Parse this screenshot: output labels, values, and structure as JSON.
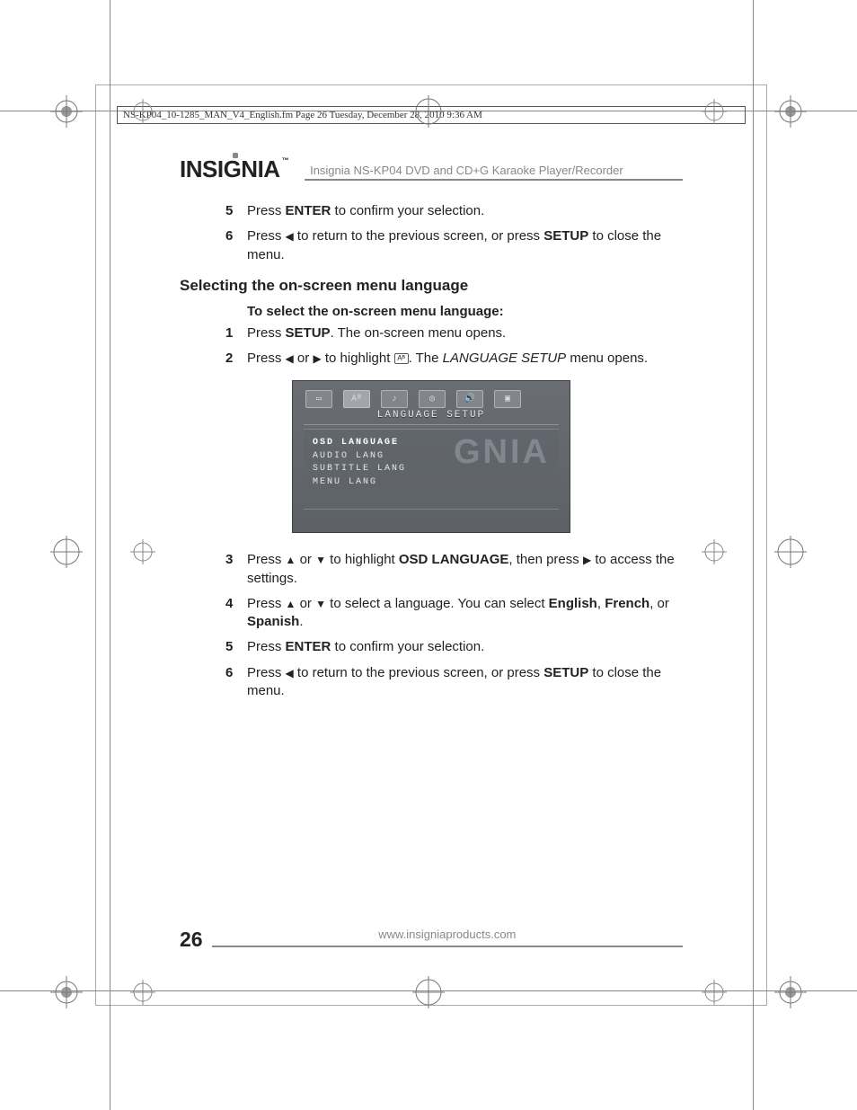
{
  "file_header": "NS-KP04_10-1285_MAN_V4_English.fm  Page 26  Tuesday, December 28, 2010  9:36 AM",
  "brand": "INSIGNIA",
  "product_line": "Insignia NS-KP04 DVD and CD+G Karaoke Player/Recorder",
  "top_steps": {
    "s5": {
      "num": "5",
      "pre": "Press ",
      "b1": "ENTER",
      "post": " to confirm your selection."
    },
    "s6": {
      "num": "6",
      "pre": "Press ",
      "g1": "◀",
      "mid": " to return to the previous screen, or press ",
      "b1": "SETUP",
      "post": " to close the menu."
    }
  },
  "section_heading": "Selecting the on-screen menu language",
  "subheading": "To select the on-screen menu language:",
  "steps": {
    "s1": {
      "num": "1",
      "pre": "Press ",
      "b1": "SETUP",
      "post": ". The on-screen menu opens."
    },
    "s2": {
      "num": "2",
      "pre": "Press ",
      "g1": "◀",
      "mid1": " or ",
      "g2": "▶",
      "mid2": " to highlight ",
      "icon": "⌂",
      "post": ". The ",
      "i1": "LANGUAGE SETUP",
      "post2": " menu opens."
    },
    "s3": {
      "num": "3",
      "pre": "Press ",
      "g1": "▲",
      "mid1": " or ",
      "g2": "▼",
      "mid2": " to highlight ",
      "b1": "OSD LANGUAGE",
      "mid3": ", then press ",
      "g3": "▶",
      "post": " to access the settings."
    },
    "s4": {
      "num": "4",
      "pre": "Press ",
      "g1": "▲",
      "mid1": " or ",
      "g2": "▼",
      "mid2": " to select a language. You can select ",
      "b1": "English",
      "mid3": ", ",
      "b2": "French",
      "mid4": ", or ",
      "b3": "Spanish",
      "post": "."
    },
    "s5": {
      "num": "5",
      "pre": "Press ",
      "b1": "ENTER",
      "post": " to confirm your selection."
    },
    "s6": {
      "num": "6",
      "pre": "Press ",
      "g1": "◀",
      "mid": " to return to the previous screen, or press ",
      "b1": "SETUP",
      "post": " to close the menu."
    }
  },
  "osd": {
    "title": "LANGUAGE  SETUP",
    "items": [
      "OSD  LANGUAGE",
      "AUDIO  LANG",
      "SUBTITLE  LANG",
      "MENU  LANG"
    ],
    "watermark": "GNIA"
  },
  "footer": {
    "page": "26",
    "url": "www.insigniaproducts.com"
  }
}
